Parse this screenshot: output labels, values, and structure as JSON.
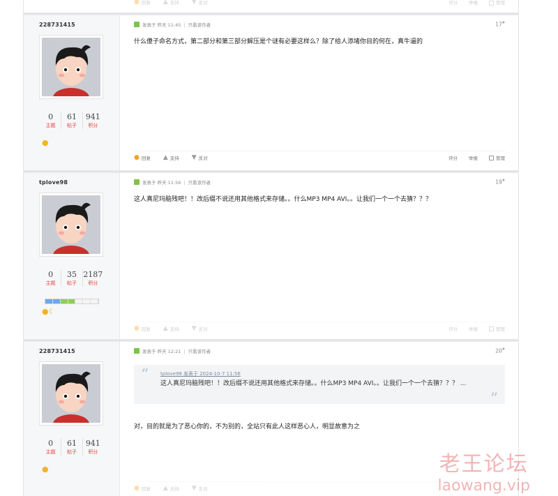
{
  "top_actions": {
    "reply": "回复",
    "support": "支持",
    "oppose": "反对",
    "rate": "评分",
    "report": "举报",
    "manage": "管理"
  },
  "posts": [
    {
      "username": "228731415",
      "stats": [
        {
          "num": "0",
          "label": "主题"
        },
        {
          "num": "61",
          "label": "帖子"
        },
        {
          "num": "941",
          "label": "积分"
        }
      ],
      "meta": {
        "posted": "发表于 昨天 11:45",
        "only_author": "只看该作者"
      },
      "floor": "17",
      "floor_sup": "#",
      "content": "什么傻子命名方式，第二部分和第三部分解压是个谜有必要这样么？除了给人添堵你目的何在，真牛逼的",
      "actions": {
        "reply": "回复",
        "support": "支持",
        "oppose": "反对",
        "rate": "评分",
        "report": "举报",
        "manage": "管理"
      }
    },
    {
      "username": "tplove98",
      "stats": [
        {
          "num": "0",
          "label": "主题"
        },
        {
          "num": "35",
          "label": "帖子"
        },
        {
          "num": "2187",
          "label": "积分"
        }
      ],
      "meta": {
        "posted": "发表于 昨天 11:56",
        "only_author": "只看该作者"
      },
      "floor": "19",
      "floor_sup": "#",
      "content": "这人真尼玛脑残吧！！改后缀不说还用其他格式来存储。。什么MP3 MP4 AVI。。让我们一个一个去猜？？？",
      "actions": {
        "reply": "回复",
        "support": "支持",
        "oppose": "反对",
        "rate": "评分",
        "report": "举报",
        "manage": "管理"
      }
    },
    {
      "username": "228731415",
      "stats": [
        {
          "num": "0",
          "label": "主题"
        },
        {
          "num": "61",
          "label": "帖子"
        },
        {
          "num": "941",
          "label": "积分"
        }
      ],
      "meta": {
        "posted": "发表于 昨天 12:21",
        "only_author": "只看该作者"
      },
      "floor": "20",
      "floor_sup": "#",
      "quote": {
        "author": "tplove98 发表于 2024-10-7 11:56",
        "text": "这人真尼玛脑残吧！！改后缀不说还用其他格式来存储。。什么MP3 MP4 AVI。。让我们一个一个去猜？？？ ..."
      },
      "content": "对，目的就是为了恶心你的，不为别的，全站只有此人这样恶心人，明显故意为之",
      "actions": {
        "reply": "回复",
        "support": "支持",
        "oppose": "反对"
      }
    }
  ],
  "watermark": {
    "title": "老王论坛",
    "domain": "laowang.vip"
  }
}
